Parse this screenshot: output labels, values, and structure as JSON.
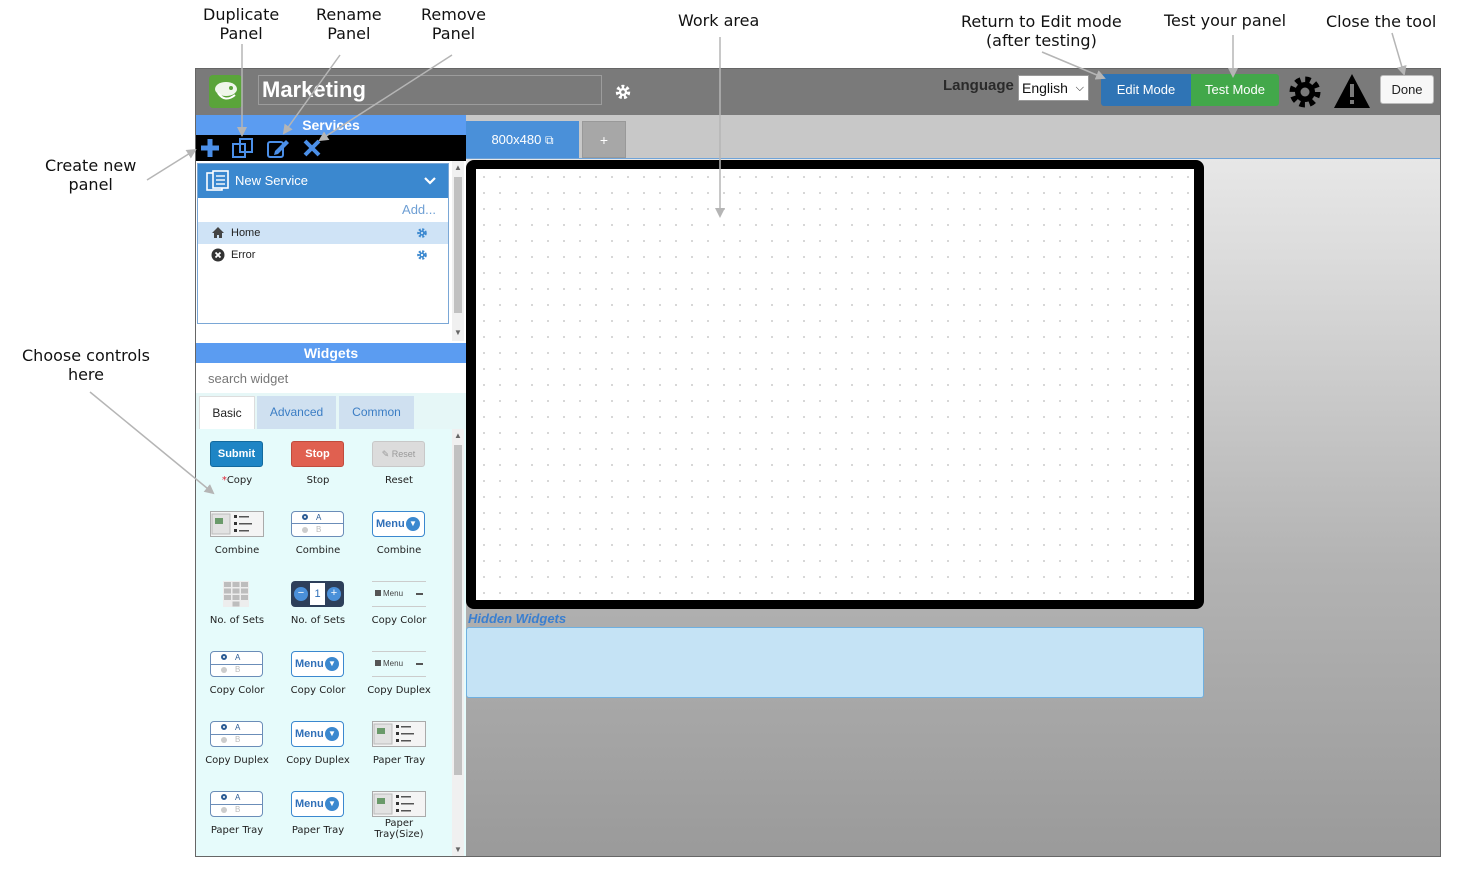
{
  "annotations": {
    "duplicate_panel": "Duplicate\nPanel",
    "rename_panel": "Rename\nPanel",
    "remove_panel": "Remove\nPanel",
    "work_area": "Work area",
    "return_edit": "Return to Edit mode\n(after testing)",
    "test_panel": "Test your panel",
    "close_tool": "Close the tool",
    "create_panel": "Create new\npanel",
    "choose_controls": "Choose controls\nhere"
  },
  "header": {
    "panel_name": "Marketing",
    "language_label": "Language",
    "language_value": "English",
    "edit_mode": "Edit Mode",
    "test_mode": "Test Mode",
    "done": "Done"
  },
  "services": {
    "title": "Services",
    "service_name": "New Service",
    "add_label": "Add...",
    "items": [
      {
        "label": "Home",
        "icon": "home-icon"
      },
      {
        "label": "Error",
        "icon": "error-icon"
      }
    ]
  },
  "widgets": {
    "title": "Widgets",
    "search_placeholder": "search widget",
    "tabs": [
      "Basic",
      "Advanced",
      "Common"
    ],
    "button_texts": {
      "submit": "Submit",
      "stop": "Stop",
      "reset": "Reset",
      "menu": "Menu",
      "stepper_value": "1",
      "radio_a": "A",
      "radio_b": "B"
    },
    "copy_prefix": "*",
    "items": [
      "Copy",
      "Stop",
      "Reset",
      "Combine",
      "Combine",
      "Combine",
      "No. of Sets",
      "No. of Sets",
      "Copy Color",
      "Copy Color",
      "Copy Color",
      "Copy Duplex",
      "Copy Duplex",
      "Copy Duplex",
      "Paper Tray",
      "Paper Tray",
      "Paper Tray",
      "Paper Tray(Size)"
    ]
  },
  "workspace": {
    "tab_label": "800x480",
    "add_tab": "+",
    "hidden_widgets": "Hidden Widgets"
  },
  "colors": {
    "accent_blue": "#5b9cf1",
    "edit_mode": "#2f74b5",
    "test_mode": "#42a84a",
    "hidden_widgets_bg": "#c5e3f5"
  }
}
